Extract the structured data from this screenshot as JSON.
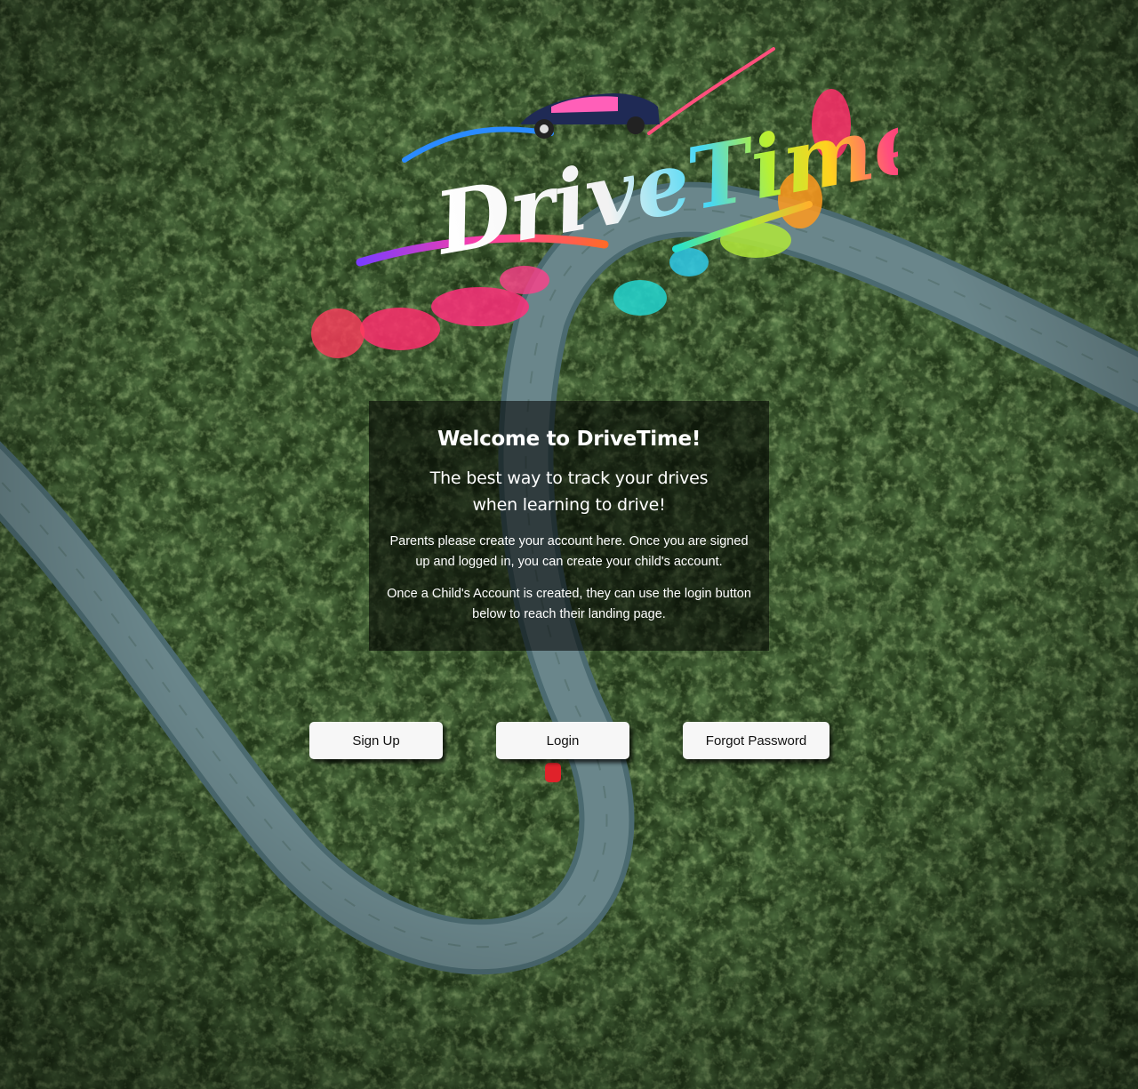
{
  "logo": {
    "text": "DriveTime"
  },
  "welcome": {
    "title": "Welcome to DriveTime!",
    "subtitle": "The best way to track your drives when learning to drive!",
    "paragraph_1": "Parents please create your account here. Once you are signed up and logged in, you can create your child's account.",
    "paragraph_2": "Once a Child's Account is created, they can use the login button below to reach their landing page."
  },
  "buttons": {
    "signup": "Sign Up",
    "login": "Login",
    "forgot_password": "Forgot Password"
  },
  "colors": {
    "panel_background": "rgba(0,0,0,0.55)",
    "button_background": "#f7f7f7",
    "forest": "#2b4a1f",
    "road": "#5e7a80"
  }
}
